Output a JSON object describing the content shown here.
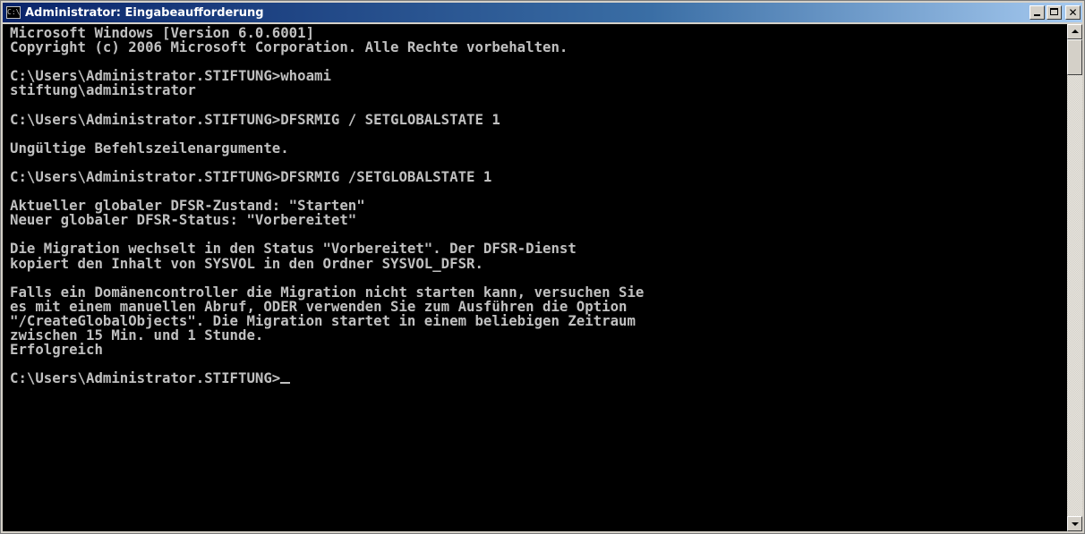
{
  "window": {
    "title": "Administrator: Eingabeaufforderung",
    "icon": "cmd-icon",
    "icon_text": "C:\\"
  },
  "console": {
    "lines": [
      "Microsoft Windows [Version 6.0.6001]",
      "Copyright (c) 2006 Microsoft Corporation. Alle Rechte vorbehalten.",
      "",
      "C:\\Users\\Administrator.STIFTUNG>whoami",
      "stiftung\\administrator",
      "",
      "C:\\Users\\Administrator.STIFTUNG>DFSRMIG / SETGLOBALSTATE 1",
      "",
      "Ungültige Befehlszeilenargumente.",
      "",
      "C:\\Users\\Administrator.STIFTUNG>DFSRMIG /SETGLOBALSTATE 1",
      "",
      "Aktueller globaler DFSR-Zustand: \"Starten\"",
      "Neuer globaler DFSR-Status: \"Vorbereitet\"",
      "",
      "Die Migration wechselt in den Status \"Vorbereitet\". Der DFSR-Dienst",
      "kopiert den Inhalt von SYSVOL in den Ordner SYSVOL_DFSR.",
      "",
      "Falls ein Domänencontroller die Migration nicht starten kann, versuchen Sie",
      "es mit einem manuellen Abruf, ODER verwenden Sie zum Ausführen die Option",
      "\"/CreateGlobalObjects\". Die Migration startet in einem beliebigen Zeitraum",
      "zwischen 15 Min. und 1 Stunde.",
      "Erfolgreich",
      ""
    ],
    "prompt": "C:\\Users\\Administrator.STIFTUNG>"
  },
  "colors": {
    "console_bg": "#000000",
    "console_fg": "#c0c0c0",
    "titlebar_start": "#0a246a",
    "titlebar_end": "#a6caf0"
  }
}
